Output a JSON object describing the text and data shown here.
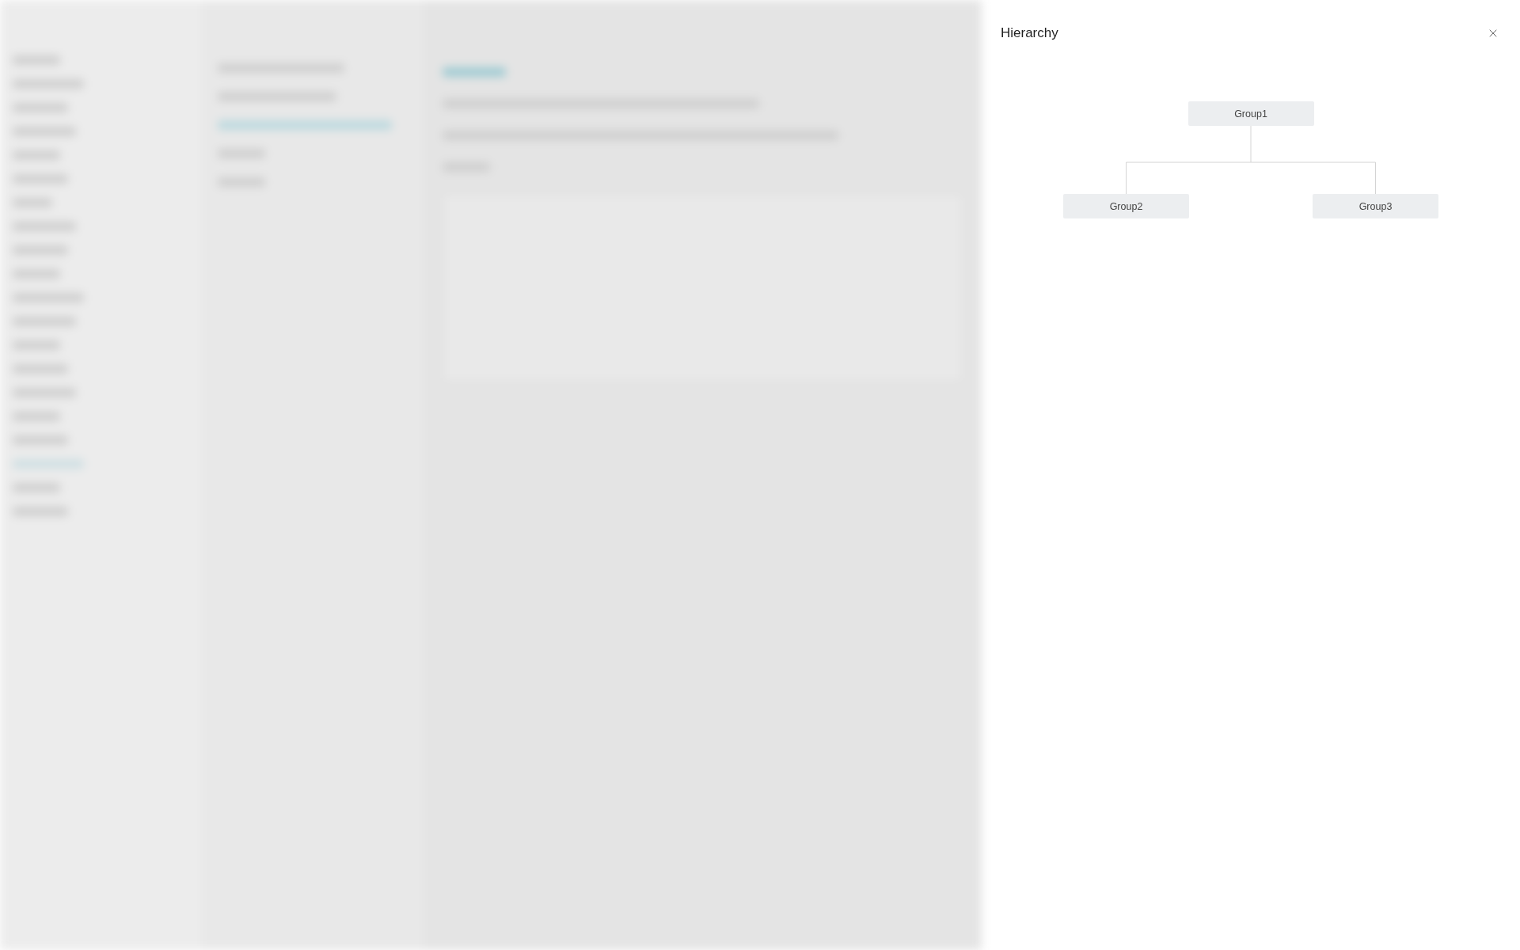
{
  "drawer": {
    "title": "Hierarchy"
  },
  "hierarchy": {
    "label": "Group1",
    "children": [
      {
        "label": "Group2"
      },
      {
        "label": "Group3"
      }
    ]
  }
}
